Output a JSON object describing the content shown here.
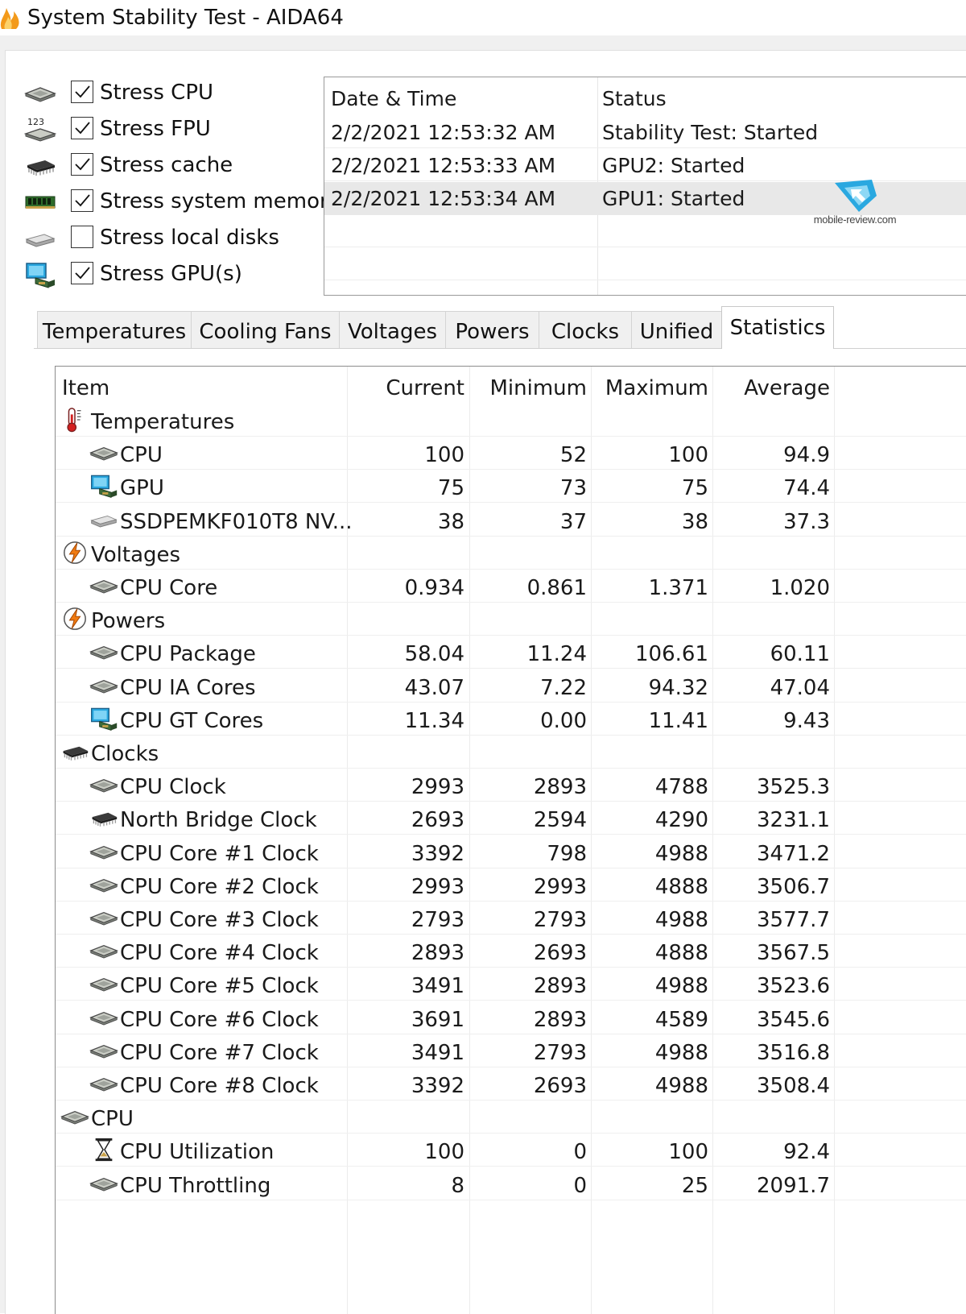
{
  "window": {
    "title": "System Stability Test - AIDA64"
  },
  "stress_options": [
    {
      "label": "Stress CPU",
      "checked": true,
      "icon": "cpu-chip-icon"
    },
    {
      "label": "Stress FPU",
      "checked": true,
      "icon": "fpu-123-icon"
    },
    {
      "label": "Stress cache",
      "checked": true,
      "icon": "cache-chip-icon"
    },
    {
      "label": "Stress system memory",
      "checked": true,
      "icon": "memory-module-icon"
    },
    {
      "label": "Stress local disks",
      "checked": false,
      "icon": "disk-drive-icon"
    },
    {
      "label": "Stress GPU(s)",
      "checked": true,
      "icon": "gpu-monitor-icon"
    }
  ],
  "log": {
    "headers": {
      "datetime": "Date & Time",
      "status": "Status"
    },
    "rows": [
      {
        "datetime": "2/2/2021 12:53:32 AM",
        "status": "Stability Test: Started"
      },
      {
        "datetime": "2/2/2021 12:53:33 AM",
        "status": "GPU2: Started"
      },
      {
        "datetime": "2/2/2021 12:53:34 AM",
        "status": "GPU1: Started"
      }
    ]
  },
  "watermark": {
    "text": "mobile-review.com"
  },
  "tabs": [
    "Temperatures",
    "Cooling Fans",
    "Voltages",
    "Powers",
    "Clocks",
    "Unified",
    "Statistics"
  ],
  "active_tab": "Statistics",
  "stats": {
    "headers": {
      "item": "Item",
      "current": "Current",
      "minimum": "Minimum",
      "maximum": "Maximum",
      "average": "Average"
    },
    "rows": [
      {
        "type": "group",
        "name": "Temperatures",
        "icon": "thermometer-icon"
      },
      {
        "type": "item",
        "name": "CPU",
        "icon": "cpu-chip-icon",
        "current": "100",
        "minimum": "52",
        "maximum": "100",
        "average": "94.9"
      },
      {
        "type": "item",
        "name": "GPU",
        "icon": "gpu-monitor-icon",
        "current": "75",
        "minimum": "73",
        "maximum": "75",
        "average": "74.4"
      },
      {
        "type": "item",
        "name": "SSDPEMKF010T8 NV...",
        "icon": "disk-drive-icon",
        "current": "38",
        "minimum": "37",
        "maximum": "38",
        "average": "37.3"
      },
      {
        "type": "group",
        "name": "Voltages",
        "icon": "lightning-icon"
      },
      {
        "type": "item",
        "name": "CPU Core",
        "icon": "cpu-chip-icon",
        "current": "0.934",
        "minimum": "0.861",
        "maximum": "1.371",
        "average": "1.020"
      },
      {
        "type": "group",
        "name": "Powers",
        "icon": "lightning-icon"
      },
      {
        "type": "item",
        "name": "CPU Package",
        "icon": "cpu-chip-icon",
        "current": "58.04",
        "minimum": "11.24",
        "maximum": "106.61",
        "average": "60.11"
      },
      {
        "type": "item",
        "name": "CPU IA Cores",
        "icon": "cpu-chip-icon",
        "current": "43.07",
        "minimum": "7.22",
        "maximum": "94.32",
        "average": "47.04"
      },
      {
        "type": "item",
        "name": "CPU GT Cores",
        "icon": "gpu-monitor-icon",
        "current": "11.34",
        "minimum": "0.00",
        "maximum": "11.41",
        "average": "9.43"
      },
      {
        "type": "group",
        "name": "Clocks",
        "icon": "cache-chip-icon"
      },
      {
        "type": "item",
        "name": "CPU Clock",
        "icon": "cpu-chip-icon",
        "current": "2993",
        "minimum": "2893",
        "maximum": "4788",
        "average": "3525.3"
      },
      {
        "type": "item",
        "name": "North Bridge Clock",
        "icon": "cache-chip-icon",
        "current": "2693",
        "minimum": "2594",
        "maximum": "4290",
        "average": "3231.1"
      },
      {
        "type": "item",
        "name": "CPU Core #1 Clock",
        "icon": "cpu-chip-icon",
        "current": "3392",
        "minimum": "798",
        "maximum": "4988",
        "average": "3471.2"
      },
      {
        "type": "item",
        "name": "CPU Core #2 Clock",
        "icon": "cpu-chip-icon",
        "current": "2993",
        "minimum": "2993",
        "maximum": "4888",
        "average": "3506.7"
      },
      {
        "type": "item",
        "name": "CPU Core #3 Clock",
        "icon": "cpu-chip-icon",
        "current": "2793",
        "minimum": "2793",
        "maximum": "4988",
        "average": "3577.7"
      },
      {
        "type": "item",
        "name": "CPU Core #4 Clock",
        "icon": "cpu-chip-icon",
        "current": "2893",
        "minimum": "2693",
        "maximum": "4888",
        "average": "3567.5"
      },
      {
        "type": "item",
        "name": "CPU Core #5 Clock",
        "icon": "cpu-chip-icon",
        "current": "3491",
        "minimum": "2893",
        "maximum": "4988",
        "average": "3523.6"
      },
      {
        "type": "item",
        "name": "CPU Core #6 Clock",
        "icon": "cpu-chip-icon",
        "current": "3691",
        "minimum": "2893",
        "maximum": "4589",
        "average": "3545.6"
      },
      {
        "type": "item",
        "name": "CPU Core #7 Clock",
        "icon": "cpu-chip-icon",
        "current": "3491",
        "minimum": "2793",
        "maximum": "4988",
        "average": "3516.8"
      },
      {
        "type": "item",
        "name": "CPU Core #8 Clock",
        "icon": "cpu-chip-icon",
        "current": "3392",
        "minimum": "2693",
        "maximum": "4988",
        "average": "3508.4"
      },
      {
        "type": "group",
        "name": "CPU",
        "icon": "cpu-chip-icon"
      },
      {
        "type": "item",
        "name": "CPU Utilization",
        "icon": "hourglass-icon",
        "current": "100",
        "minimum": "0",
        "maximum": "100",
        "average": "92.4"
      },
      {
        "type": "item",
        "name": "CPU Throttling",
        "icon": "cpu-chip-icon",
        "current": "8",
        "minimum": "0",
        "maximum": "25",
        "average": "2091.7"
      }
    ]
  },
  "colors": {
    "accent_blue": "#2aa8e0",
    "selection_gray": "#e8e8e8",
    "tab_bg": "#f0f0f0"
  }
}
